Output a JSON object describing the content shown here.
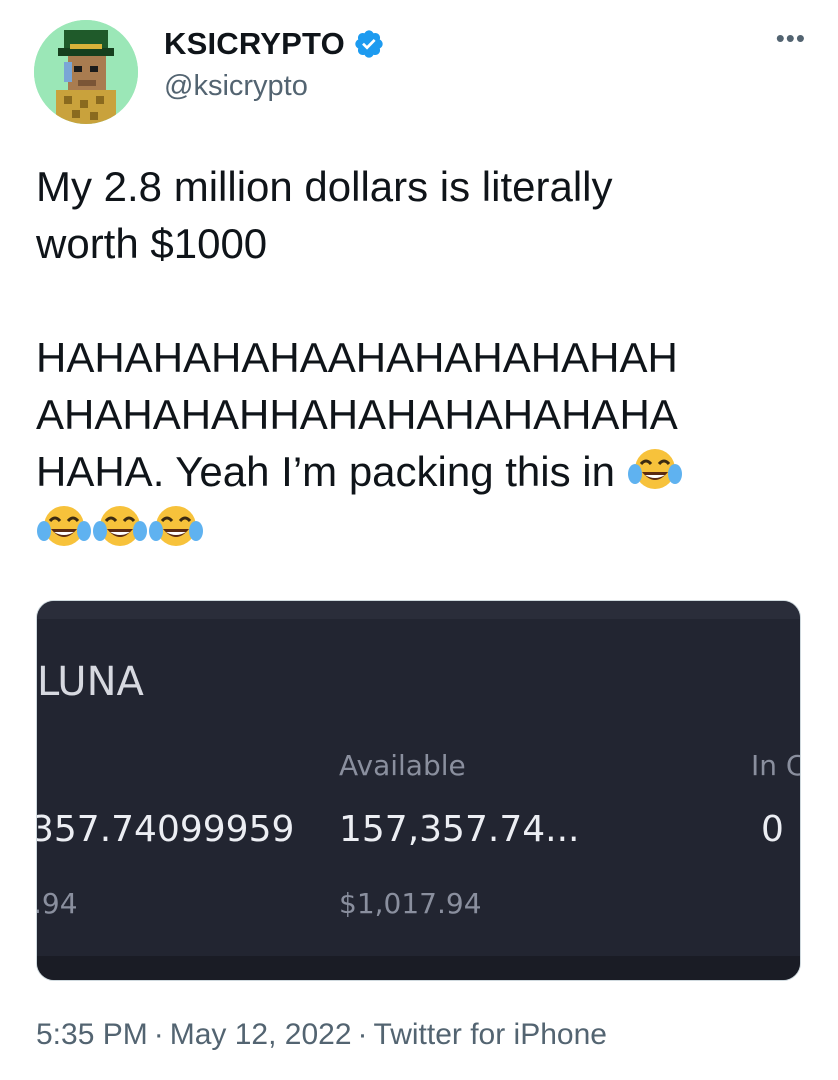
{
  "author": {
    "display_name": "KSICRYPTO",
    "handle": "@ksicrypto",
    "verified": true,
    "avatar_icon": "pixel-art-nft-avatar"
  },
  "more_label": "•••",
  "tweet": {
    "line1": "My 2.8 million dollars is literally",
    "line2": "worth $1000",
    "line3": "HAHAHAHAHAAHAHAHAHAHAH",
    "line4": "AHAHAHAHHAHAHAHAHAHAHA",
    "line5": "HAHA. Yeah I’m packing this in",
    "emoji": "face-with-tears-of-joy"
  },
  "media": {
    "coin": "LUNA",
    "available_label": "Available",
    "in_order_label": "In C",
    "total_value": "357.74099959",
    "available_value": "157,357.74...",
    "in_order_value": "0",
    "total_usd": ".94",
    "available_usd": "$1,017.94"
  },
  "meta": {
    "time": "5:35 PM",
    "date": "May 12, 2022",
    "source": "Twitter for iPhone",
    "separator": "·"
  },
  "colors": {
    "text": "#0f1419",
    "secondary": "#536471",
    "verified_blue": "#1d9bf0",
    "card_bg": "#222531"
  }
}
